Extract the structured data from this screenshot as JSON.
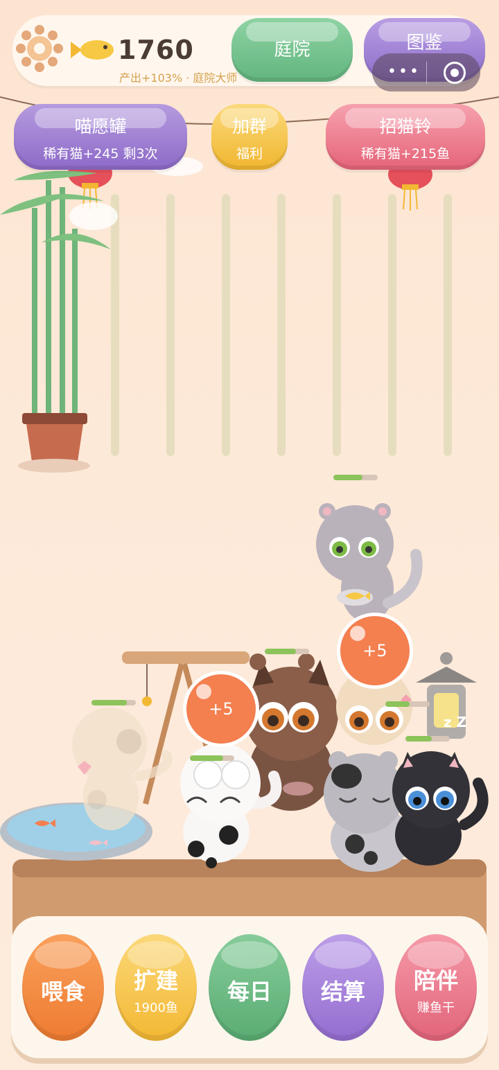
{
  "header": {
    "fish_count": "1760",
    "production_text": "产出+103% · 庭院大师",
    "tab_yard": "庭院",
    "tab_book": "图鉴"
  },
  "actions": {
    "wish": {
      "title": "喵愿罐",
      "sub": "稀有猫+245 剩3次"
    },
    "group": {
      "title": "加群",
      "sub": "福利"
    },
    "bell": {
      "title": "招猫铃",
      "sub": "稀有猫+215鱼"
    }
  },
  "bubbles": [
    "+5",
    "+5"
  ],
  "sleep": "z Z",
  "bottom": {
    "feed": "喂食",
    "expand": "扩建",
    "expand_cost": "1900鱼",
    "daily": "每日",
    "settle": "结算",
    "company": "陪伴",
    "company_sub": "赚鱼干"
  },
  "colors": {
    "background": "#fde6d3",
    "accent_green": "#62b57d",
    "accent_purple": "#8c6cc9",
    "accent_red": "#e56479",
    "accent_orange": "#ee7b31",
    "accent_yellow": "#f3b833"
  },
  "hp_levels": {
    "gray_cat_top": 0.65,
    "brown_cat": 0.7,
    "cream_cat": 0.8,
    "white_cat": 0.75,
    "tan_cat": 0.55,
    "black_cat": 0.6
  }
}
